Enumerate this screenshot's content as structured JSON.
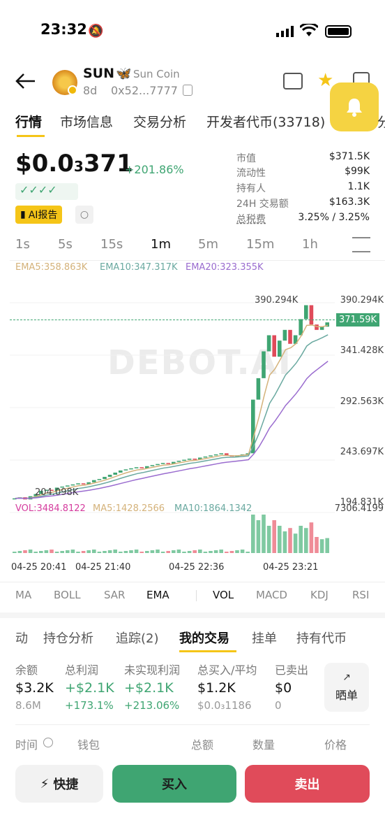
{
  "status": {
    "time": "23:32"
  },
  "token": {
    "symbol": "SUN",
    "name": "Sun Coin",
    "age": "8d",
    "address": "0x52...7777",
    "price_prefix": "$0.0",
    "price_sub": "3",
    "price_suffix": "371",
    "change": "+201.86%"
  },
  "tabs": [
    "行情",
    "市场信息",
    "交易分析",
    "开发者代币(33718)",
    "分"
  ],
  "stats": [
    {
      "label": "市值",
      "value": "$371.5K"
    },
    {
      "label": "流动性",
      "value": "$99K"
    },
    {
      "label": "持有人",
      "value": "1.1K"
    },
    {
      "label": "24H 交易额",
      "value": "$163.3K"
    },
    {
      "label": "总税费",
      "value": "3.25% / 3.25%"
    }
  ],
  "ai_report": "AI报告",
  "timeframes": [
    "1s",
    "5s",
    "15s",
    "1m",
    "5m",
    "15m",
    "1h"
  ],
  "active_timeframe": "1m",
  "ema_legend": {
    "ema5": "EMA5:358.863K",
    "ema10": "EMA10:347.317K",
    "ema20": "EMA20:323.355K"
  },
  "watermark": "DEBOT.AI",
  "price_axis": [
    "390.294K",
    "341.428K",
    "292.563K",
    "243.697K",
    "194.831K"
  ],
  "current_price_label": "371.59K",
  "high_label": "390.294K",
  "low_label": "204.098K",
  "vol_legend": {
    "vol": "VOL:3484.8122",
    "ma5": "MA5:1428.2566",
    "ma10": "MA10:1864.1342"
  },
  "vol_axis_max": "7306.4199",
  "time_axis": [
    "04-25 20:41",
    "04-25 21:40",
    "04-25 22:36",
    "04-25 23:21"
  ],
  "indicators": [
    "MA",
    "BOLL",
    "SAR",
    "EMA",
    "VOL",
    "MACD",
    "KDJ",
    "RSI"
  ],
  "section_tabs": [
    "动",
    "持仓分析",
    "追踪(2)",
    "我的交易",
    "挂单",
    "持有代币"
  ],
  "metrics": [
    {
      "label": "余额",
      "value": "$3.2K",
      "sub": "8.6M"
    },
    {
      "label": "总利润",
      "value": "+$2.1K",
      "sub": "+173.1%"
    },
    {
      "label": "未实现利润",
      "value": "+$2.1K",
      "sub": "+213.06%"
    },
    {
      "label": "总买入/平均",
      "value": "$1.2K",
      "sub": "$0.0₃1186"
    },
    {
      "label": "已卖出",
      "value": "$0",
      "sub": "0"
    }
  ],
  "share_label": "晒单",
  "table_headers": [
    "时间",
    "钱包",
    "总额",
    "数量",
    "价格"
  ],
  "buttons": {
    "quick": "快捷",
    "buy": "买入",
    "sell": "卖出"
  },
  "colors": {
    "accent": "#f5c518",
    "up": "#3fa572",
    "down": "#e04b5a",
    "buy": "#3fa572",
    "sell": "#e04b5a"
  },
  "chart_data": {
    "type": "candlestick",
    "price_range": [
      194831,
      390294
    ],
    "current_price": 371590,
    "candles_close": [
      208000,
      209000,
      207000,
      210000,
      212000,
      215000,
      216000,
      215000,
      218000,
      219000,
      220000,
      221000,
      222000,
      221000,
      223000,
      225000,
      226000,
      228000,
      230000,
      232000,
      234000,
      235000,
      236000,
      237000,
      236000,
      238000,
      239000,
      240000,
      241000,
      240000,
      242000,
      243000,
      244000,
      245000,
      244000,
      246000,
      247000,
      248000,
      249000,
      250000,
      248000,
      247000,
      248000,
      249000,
      250000,
      300000,
      320000,
      345000,
      360000,
      340000,
      355000,
      365000,
      352000,
      360000,
      375000,
      388000,
      370000,
      365000,
      368000,
      372000
    ],
    "volume_max": 7306.4199
  }
}
